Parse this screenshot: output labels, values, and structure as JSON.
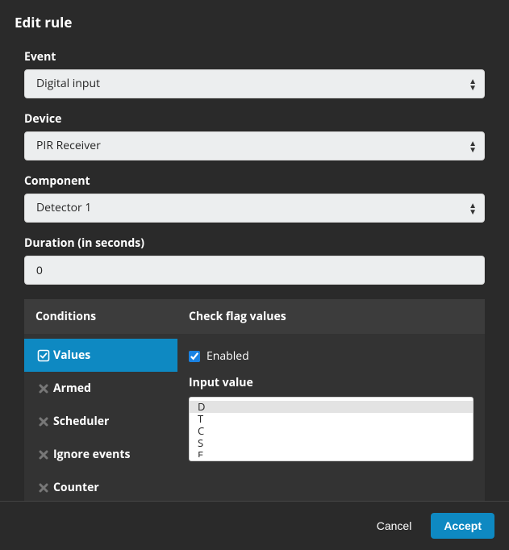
{
  "dialog": {
    "title": "Edit rule"
  },
  "form": {
    "event_label": "Event",
    "event_value": "Digital input",
    "device_label": "Device",
    "device_value": "PIR Receiver",
    "component_label": "Component",
    "component_value": "Detector 1",
    "duration_label": "Duration (in seconds)",
    "duration_value": "0"
  },
  "conditions": {
    "left_heading": "Conditions",
    "right_heading": "Check flag values",
    "tabs": [
      {
        "label": "Values",
        "active": true,
        "checked": true
      },
      {
        "label": "Armed",
        "active": false,
        "checked": false
      },
      {
        "label": "Scheduler",
        "active": false,
        "checked": false
      },
      {
        "label": "Ignore events",
        "active": false,
        "checked": false
      },
      {
        "label": "Counter",
        "active": false,
        "checked": false
      }
    ],
    "enabled_label": "Enabled",
    "enabled_checked": true,
    "input_value_label": "Input value",
    "input_values": [
      "D",
      "T",
      "C",
      "S",
      "E"
    ],
    "input_value_selected": "D"
  },
  "footer": {
    "cancel": "Cancel",
    "accept": "Accept"
  }
}
